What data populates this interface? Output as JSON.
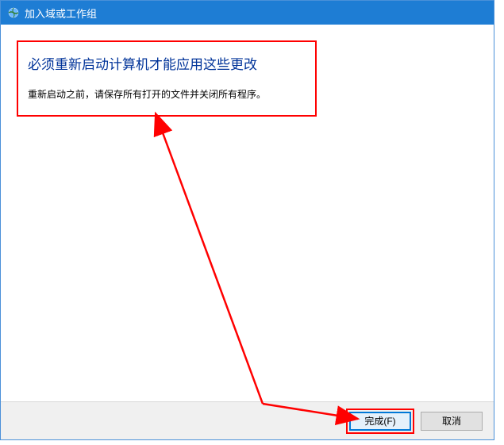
{
  "titlebar": {
    "title": "加入域或工作组"
  },
  "message": {
    "heading": "必须重新启动计算机才能应用这些更改",
    "subtext": "重新启动之前，请保存所有打开的文件并关闭所有程序。"
  },
  "footer": {
    "finish_label": "完成(F)",
    "cancel_label": "取消"
  }
}
